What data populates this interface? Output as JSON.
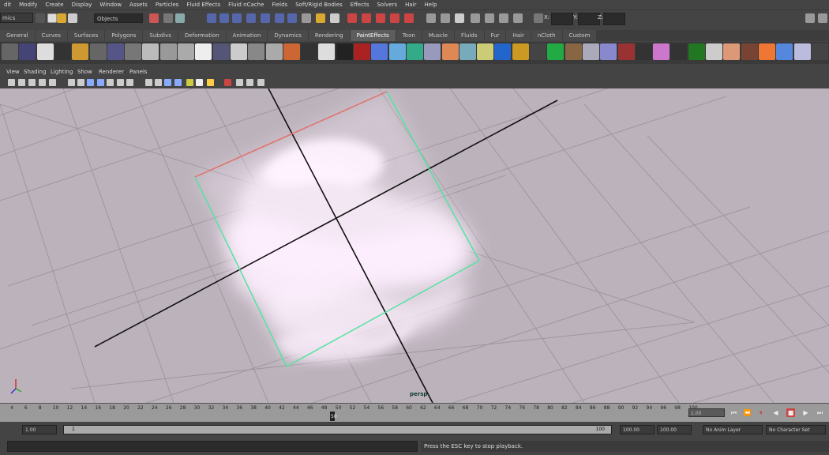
{
  "menubar": {
    "items": [
      "dit",
      "Modify",
      "Create",
      "Display",
      "Window",
      "Assets",
      "Particles",
      "Fluid Effects",
      "Fluid nCache",
      "Fields",
      "Soft/Rigid Bodies",
      "Effects",
      "Solvers",
      "Hair",
      "Help"
    ]
  },
  "statusline": {
    "mode": "mics",
    "selection_field": "Objects",
    "x_label": "X:",
    "y_label": "Y:",
    "z_label": "Z:"
  },
  "shelf_tabs": {
    "items": [
      "General",
      "Curves",
      "Surfaces",
      "Polygons",
      "Subdivs",
      "Deformation",
      "Animation",
      "Dynamics",
      "Rendering",
      "PaintEffects",
      "Toon",
      "Muscle",
      "Fluids",
      "Fur",
      "Hair",
      "nCloth",
      "Custom"
    ],
    "active": "PaintEffects"
  },
  "panel_menu": {
    "items": [
      "View",
      "Shading",
      "Lighting",
      "Show",
      "Renderer",
      "Panels"
    ]
  },
  "viewport": {
    "camera": "persp",
    "background_color": "#bcb2bc"
  },
  "timeslider": {
    "ticks": [
      "4",
      "6",
      "8",
      "10",
      "12",
      "14",
      "16",
      "18",
      "20",
      "22",
      "24",
      "26",
      "28",
      "30",
      "32",
      "34",
      "36",
      "38",
      "40",
      "42",
      "44",
      "46",
      "48",
      "50",
      "52",
      "54",
      "56",
      "58",
      "60",
      "62",
      "64",
      "66",
      "68",
      "70",
      "72",
      "74",
      "76",
      "78",
      "80",
      "82",
      "84",
      "86",
      "88",
      "90",
      "92",
      "94",
      "96",
      "98",
      "100"
    ],
    "current_frame_label": "50",
    "current_time": "1.00"
  },
  "rangeslider": {
    "start_time": "1.00",
    "range_start": "1",
    "range_end": "100",
    "end_time": "100.00",
    "anim_end": "100.00",
    "anim_layer": "No Anim Layer",
    "character_set": "No Character Set"
  },
  "cmdline": {
    "help_text": "Press the ESC key to stop playback."
  },
  "colors": {
    "accent_active_tab": "#5d5d5d",
    "fluid_container_edge": "#55e2a2",
    "fluid_fog": "#fbeefb"
  }
}
